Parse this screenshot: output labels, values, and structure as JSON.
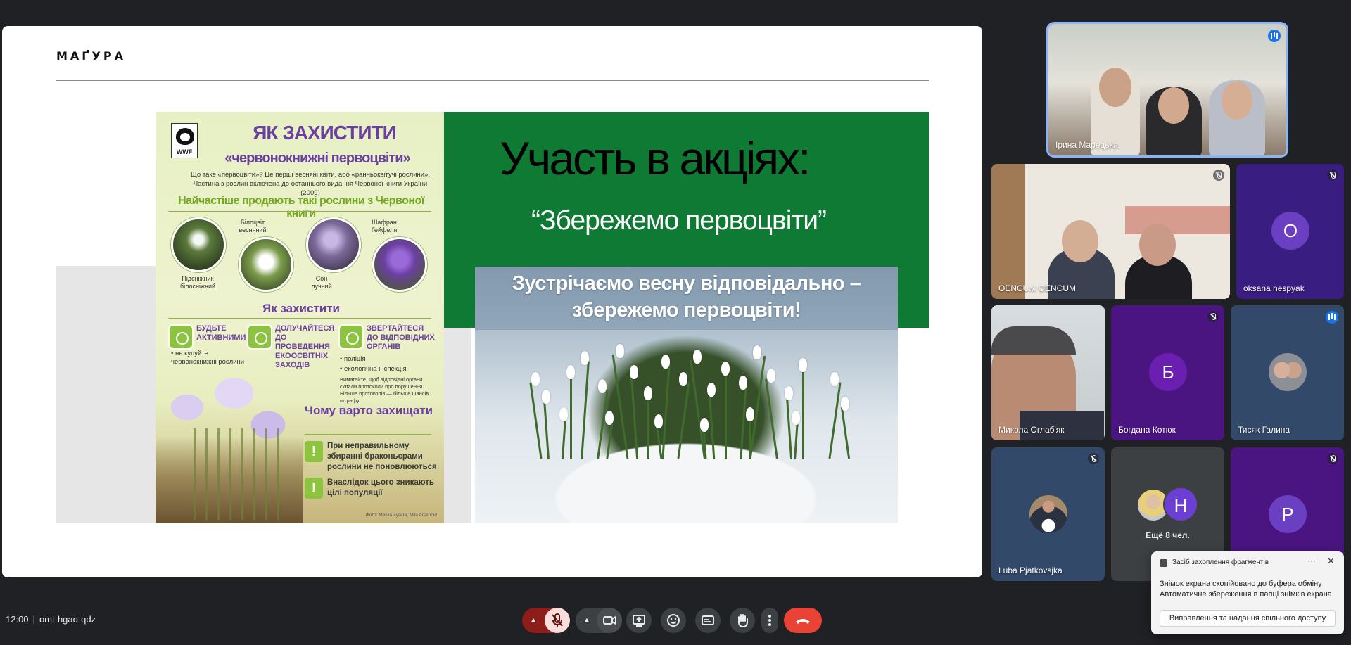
{
  "slide": {
    "brand": "МАҐУРА",
    "title": "Участь в акціях:",
    "quote": "“Збережемо первоцвіти”",
    "photo_caption_1": "Зустрічаємо весну відповідально –",
    "photo_caption_2": "збережемо первоцвіти!",
    "poster": {
      "logo": "WWF",
      "title": "ЯК ЗАХИСТИТИ",
      "subtitle": "«червонокнижні первоцвіти»",
      "intro_1": "Що таке «первоцвіти»? Це перші весняні квіти, або «ранньоквітучі рослини».",
      "intro_2": "Частина з рослин включена до останнього видання Червоної книги України (2009)",
      "heading_sold": "Найчастіше продають такі рослини з Червоної книги",
      "plant_1": "Підсніжник білосніжний",
      "plant_2": "Білоцвіт весняний",
      "plant_3": "Сон лучний",
      "plant_4": "Шафран Гейфеля",
      "heading_protect": "Як захистити",
      "tip_1_title": "БУДЬТЕ АКТИВНИМИ",
      "tip_1_text": "• не купуйте червонокнижні рослини",
      "tip_2_title": "ДОЛУЧАЙТЕСЯ ДО ПРОВЕДЕННЯ ЕКООСВІТНІХ ЗАХОДІВ",
      "tip_3_title": "ЗВЕРТАЙТЕСЯ ДО ВІДПОВІДНИХ ОРГАНІВ",
      "tip_3_a": "• поліція",
      "tip_3_b": "• екологічна інспекція",
      "tip_3_note": "Вимагайте, щоб відповідні органи склали протоколи про порушення. Більше протоколів — більше шансів штрафу.",
      "heading_why": "Чому варто захищати",
      "why_1": "При неправильному збиранні браконьєрами рослини не поновлюються",
      "why_2": "Внаслідок цього зникають цілі популяції",
      "credit": "Фото: Maxiia Zyliera, Mila Arsenoid"
    }
  },
  "participants": [
    {
      "name": "Ірина Марецька",
      "status": "speaking"
    },
    {
      "name": "OENCUM OENCUM",
      "status": "muted"
    },
    {
      "name": "oksana nespyak",
      "initial": "O",
      "status": "muted",
      "color": "#6a3fc2"
    },
    {
      "name": "Микола Оглаб'як",
      "status": "unmuted"
    },
    {
      "name": "Богдана Котюк",
      "initial": "Б",
      "status": "muted",
      "color": "#6a1fb0"
    },
    {
      "name": "Тисяк Галина",
      "status": "muted"
    },
    {
      "name": "Luba Pjatkovsjka",
      "status": "muted"
    },
    {
      "name": "Ещё 8 чел.",
      "initial": "Н",
      "color": "#6c3fd4"
    },
    {
      "name": "",
      "initial": "P",
      "status": "muted",
      "color": "#6a3fc2"
    }
  ],
  "bottom_bar": {
    "time": "12:00",
    "meeting_code": "omt-hgao-qdz"
  },
  "toast": {
    "app_name": "Засіб захоплення фрагментів",
    "line_1": "Знімок екрана скопійовано до буфера обміну",
    "line_2": "Автоматичне збереження в папці знімків екрана.",
    "action": "Виправлення та надання спільного доступу"
  },
  "colors": {
    "background": "#202124",
    "slide_green": "#0e7a34",
    "poster_purple": "#6b3fa0",
    "end_call": "#ea4335",
    "active_speaker_border": "#8ab4f8"
  }
}
